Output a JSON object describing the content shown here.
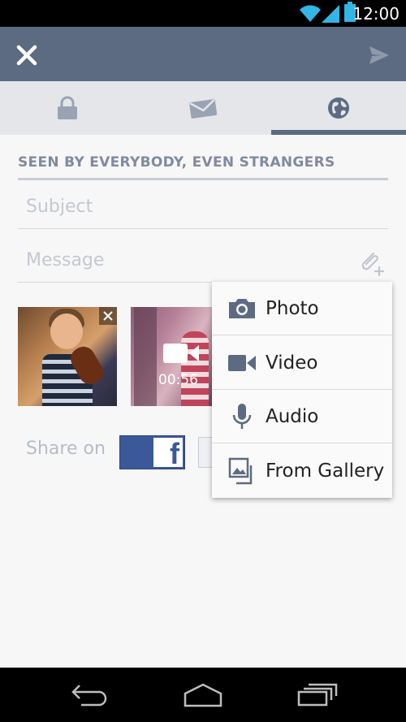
{
  "statusbar": {
    "time": "12:00"
  },
  "appbar": {
    "close_icon": "close-icon",
    "send_icon": "send-icon"
  },
  "tabs": [
    {
      "icon": "lock-icon",
      "name": "private"
    },
    {
      "icon": "envelope-icon",
      "name": "message"
    },
    {
      "icon": "globe-icon",
      "name": "public",
      "selected": true
    }
  ],
  "privacy_label": "SEEN BY EVERYBODY, EVEN STRANGERS",
  "subject": {
    "placeholder": "Subject",
    "value": ""
  },
  "message": {
    "placeholder": "Message",
    "value": ""
  },
  "attachments": [
    {
      "type": "photo"
    },
    {
      "type": "video",
      "duration": "00:56"
    }
  ],
  "share": {
    "label": "Share on",
    "facebook_glyph": "f"
  },
  "menu": {
    "items": [
      {
        "label": "Photo",
        "icon": "camera-icon"
      },
      {
        "label": "Video",
        "icon": "video-camera-icon"
      },
      {
        "label": "Audio",
        "icon": "microphone-icon"
      },
      {
        "label": "From Gallery",
        "icon": "gallery-icon"
      }
    ]
  },
  "colors": {
    "appbar": "#5c6b82",
    "accent_indicator": "#5c6b82",
    "facebook": "#3b5998",
    "status_icons": "#33b5e5"
  }
}
